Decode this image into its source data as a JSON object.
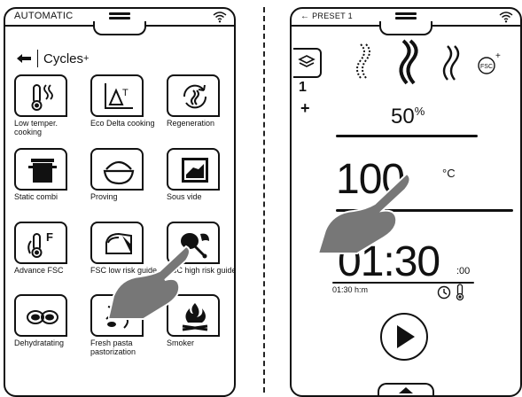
{
  "left_screen": {
    "mode": "AUTOMATIC",
    "title": "Cycles",
    "title_suffix": "+",
    "tiles": [
      {
        "label": "Low temper. cooking",
        "icon": "low-temperature-icon"
      },
      {
        "label": "Eco Delta cooking",
        "icon": "delta-t-icon"
      },
      {
        "label": "Regeneration",
        "icon": "regeneration-icon"
      },
      {
        "label": "Static combi",
        "icon": "pot-icon"
      },
      {
        "label": "Proving",
        "icon": "dough-bowl-icon"
      },
      {
        "label": "Sous vide",
        "icon": "vacuum-bag-icon"
      },
      {
        "label": "Advance FSC",
        "icon": "probe-f-icon"
      },
      {
        "label": "FSC low risk guide",
        "icon": "loaf-icon"
      },
      {
        "label": "FSC high risk guide",
        "icon": "chicken-leg-icon"
      },
      {
        "label": "Dehydratating",
        "icon": "drying-icon"
      },
      {
        "label": "Fresh pasta pastorization",
        "icon": "pasta-icon"
      },
      {
        "label": "Smoker",
        "icon": "fire-icon"
      }
    ]
  },
  "right_screen": {
    "preset": "PRESET 1",
    "humidity_value": "50",
    "humidity_unit": "%",
    "temperature": "100",
    "temperature_unit": "°C",
    "timer_main": "01:30",
    "timer_sub": ":00",
    "timer_label": "01:30 h:m",
    "fan_speed_selected": 2,
    "side_tab_number": "1",
    "side_tab_plus": "+",
    "fsc_badge": "FSC"
  },
  "colors": {
    "line": "#111111",
    "hand": "#777777",
    "background": "#ffffff"
  }
}
